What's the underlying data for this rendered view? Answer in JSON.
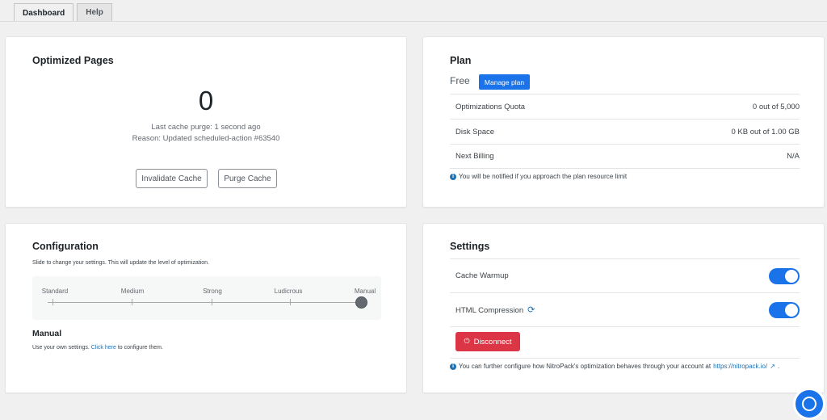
{
  "tabs": [
    {
      "label": "Dashboard",
      "active": true
    },
    {
      "label": "Help",
      "active": false
    }
  ],
  "optimized": {
    "title": "Optimized Pages",
    "count": "0",
    "last_purge": "Last cache purge: 1 second ago",
    "reason": "Reason: Updated scheduled-action #63540",
    "invalidate_label": "Invalidate Cache",
    "purge_label": "Purge Cache"
  },
  "plan": {
    "title": "Plan",
    "plan_name": "Free",
    "manage_label": "Manage plan",
    "rows": [
      {
        "label": "Optimizations Quota",
        "value": "0 out of 5,000"
      },
      {
        "label": "Disk Space",
        "value": "0 KB out of 1.00 GB"
      },
      {
        "label": "Next Billing",
        "value": "N/A"
      }
    ],
    "note": "You will be notified if you approach the plan resource limit"
  },
  "config": {
    "title": "Configuration",
    "description": "Slide to change your settings. This will update the level of optimization.",
    "levels": [
      "Standard",
      "Medium",
      "Strong",
      "Ludicrous",
      "Manual"
    ],
    "selected_level": "Manual",
    "mode_title": "Manual",
    "mode_desc_before": "Use your own settings.",
    "mode_desc_link": "Click here",
    "mode_desc_after": "to configure them."
  },
  "settings": {
    "title": "Settings",
    "cache_warmup_label": "Cache Warmup",
    "cache_warmup_on": true,
    "html_compression_label": "HTML Compression",
    "html_compression_on": true,
    "disconnect_label": "Disconnect",
    "note_text": "You can further configure how NitroPack's optimization behaves through your account at",
    "note_link": "https://nitropack.io/",
    "note_suffix": "."
  },
  "colors": {
    "primary": "#1a73e8",
    "danger": "#dc3545",
    "link": "#2271b1"
  }
}
